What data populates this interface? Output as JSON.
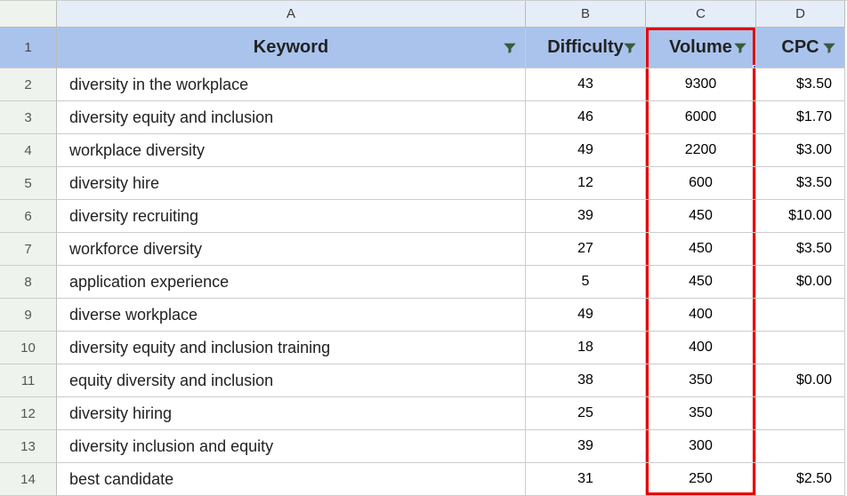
{
  "columns": {
    "letters": [
      "A",
      "B",
      "C",
      "D"
    ],
    "headers": [
      "Keyword",
      "Difficulty",
      "Volume",
      "CPC"
    ]
  },
  "rows": [
    {
      "n": 2,
      "keyword": "diversity in the workplace",
      "difficulty": "43",
      "volume": "9300",
      "cpc": "$3.50"
    },
    {
      "n": 3,
      "keyword": "diversity equity and inclusion",
      "difficulty": "46",
      "volume": "6000",
      "cpc": "$1.70"
    },
    {
      "n": 4,
      "keyword": "workplace diversity",
      "difficulty": "49",
      "volume": "2200",
      "cpc": "$3.00"
    },
    {
      "n": 5,
      "keyword": "diversity hire",
      "difficulty": "12",
      "volume": "600",
      "cpc": "$3.50"
    },
    {
      "n": 6,
      "keyword": "diversity recruiting",
      "difficulty": "39",
      "volume": "450",
      "cpc": "$10.00"
    },
    {
      "n": 7,
      "keyword": "workforce diversity",
      "difficulty": "27",
      "volume": "450",
      "cpc": "$3.50"
    },
    {
      "n": 8,
      "keyword": "application experience",
      "difficulty": "5",
      "volume": "450",
      "cpc": "$0.00"
    },
    {
      "n": 9,
      "keyword": "diverse workplace",
      "difficulty": "49",
      "volume": "400",
      "cpc": ""
    },
    {
      "n": 10,
      "keyword": "diversity equity and inclusion training",
      "difficulty": "18",
      "volume": "400",
      "cpc": ""
    },
    {
      "n": 11,
      "keyword": "equity diversity and inclusion",
      "difficulty": "38",
      "volume": "350",
      "cpc": "$0.00"
    },
    {
      "n": 12,
      "keyword": "diversity hiring",
      "difficulty": "25",
      "volume": "350",
      "cpc": ""
    },
    {
      "n": 13,
      "keyword": "diversity inclusion and equity",
      "difficulty": "39",
      "volume": "300",
      "cpc": ""
    },
    {
      "n": 14,
      "keyword": "best candidate",
      "difficulty": "31",
      "volume": "250",
      "cpc": "$2.50"
    }
  ],
  "selected_column": "C",
  "highlight_column": "C",
  "chart_data": {
    "type": "table",
    "columns": [
      "Keyword",
      "Difficulty",
      "Volume",
      "CPC"
    ],
    "rows": [
      [
        "diversity in the workplace",
        43,
        9300,
        3.5
      ],
      [
        "diversity equity and inclusion",
        46,
        6000,
        1.7
      ],
      [
        "workplace diversity",
        49,
        2200,
        3.0
      ],
      [
        "diversity hire",
        12,
        600,
        3.5
      ],
      [
        "diversity recruiting",
        39,
        450,
        10.0
      ],
      [
        "workforce diversity",
        27,
        450,
        3.5
      ],
      [
        "application experience",
        5,
        450,
        0.0
      ],
      [
        "diverse workplace",
        49,
        400,
        null
      ],
      [
        "diversity equity and inclusion training",
        18,
        400,
        null
      ],
      [
        "equity diversity and inclusion",
        38,
        350,
        0.0
      ],
      [
        "diversity hiring",
        25,
        350,
        null
      ],
      [
        "diversity inclusion and equity",
        39,
        300,
        null
      ],
      [
        "best candidate",
        31,
        250,
        2.5
      ]
    ]
  }
}
